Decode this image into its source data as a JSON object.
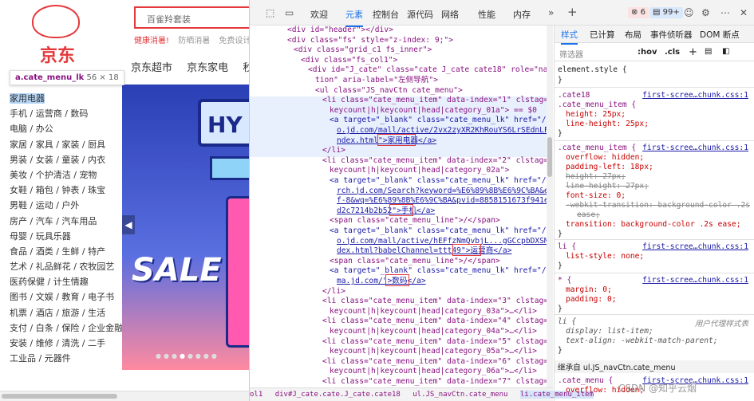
{
  "site": {
    "logo_text": "京东",
    "search_placeholder": "百雀羚套装",
    "hotwords": [
      "健康消暑!",
      "防晒消暑",
      "免费设计"
    ],
    "nav": [
      "京东超市",
      "京东家电",
      "秒杀"
    ],
    "tooltip_selector": "a.cate_menu_lk",
    "tooltip_size": "56 × 18",
    "categories": [
      "家用电器",
      "手机 / 运营商 / 数码",
      "电脑 / 办公",
      "家居 / 家具 / 家装 / 厨具",
      "男装 / 女装 / 童装 / 内衣",
      "美妆 / 个护清洁 / 宠物",
      "女鞋 / 箱包 / 钟表 / 珠宝",
      "男鞋 / 运动 / 户外",
      "房产 / 汽车 / 汽车用品",
      "母婴 / 玩具乐器",
      "食品 / 酒类 / 生鲜 / 特产",
      "艺术 / 礼品鲜花 / 农牧园艺",
      "医药保健 / 计生情趣",
      "图书 / 文娱 / 教育 / 电子书",
      "机票 / 酒店 / 旅游 / 生活",
      "支付 / 白条 / 保险 / 企业金融",
      "安装 / 维修 / 清洗 / 二手",
      "工业品 / 元器件"
    ],
    "banner_hy": "HY",
    "banner_sale": "SALE",
    "banner_arrow": "◀"
  },
  "devtools": {
    "tabs": [
      "欢迎",
      "元素",
      "控制台",
      "源代码",
      "网络",
      "性能",
      "内存"
    ],
    "active_tab": "元素",
    "errors": "6",
    "messages": "99+",
    "dom_lines": [
      "<div id=\"header\"></div>",
      "<div class=\"fs\" style=\"z-index: 9;\">",
      "<div class=\"grid_c1 fs_inner\">",
      "<div class=\"fs_col1\">",
      "<div id=\"J_cate\" class=\"cate J_cate cate18\" role=\"naviga",
      "tion\" aria-label=\"左侧导航\">",
      "<ul class=\"JS_navCtn cate_menu\">",
      "<li class=\"cate_menu_item\" data-index=\"1\" clstag=\"h|",
      "keycount|h|keycount|head|category_01a\"> == $0",
      "<a target=\"_blank\" class=\"cate_menu_lk\" href=\"//pr",
      "o.jd.com/mall/active/2vx2zyXR2KhRouYS6LrSEdnLF1P5/i",
      "ndex.html\">家用电器</a>",
      "</li>",
      "<li class=\"cate_menu_item\" data-index=\"2\" clstag=\"h|",
      "keycount|h|keycount|head|category_02a\">",
      "<a target=\"_blank\" class=\"cate_menu_lk\" href=\"//sea",
      "rch.jd.com/Search?keyword=%E6%89%8B%E6%9C%BA&enc=ut",
      "f-8&wq=%E6%89%8B%E6%9C%BA&pvid=8858151673f941e9b1a4",
      "d2c7214b2b52\">手机</a>",
      "<span class=\"cate_menu_line\">/</span>",
      "<a target=\"_blank\" class=\"cate_menu_lk\" href=\"//pr",
      "o.jd.com/mall/active/hEFfzNmQvbjL...gGCcpbDXSMYkP/in",
      "dex.html?babelChannel=ttt49\">运营商</a>",
      "<span class=\"cate_menu_line\">/</span>",
      "<a target=\"_blank\" class=\"cate_menu_lk\" href=\"//shu",
      "ma.jd.com/\">数码</a>",
      "</li>",
      "<li class=\"cate_menu_item\" data-index=\"3\" clstag=\"h|",
      "keycount|h|keycount|head|category_03a\">…</li>",
      "<li class=\"cate_menu_item\" data-index=\"4\" clstag=\"h|",
      "keycount|h|keycount|head|category_04a\">…</li>",
      "<li class=\"cate_menu_item\" data-index=\"5\" clstag=\"h|",
      "keycount|h|keycount|head|category_05a\">…</li>",
      "<li class=\"cate_menu_item\" data-index=\"6\" clstag=\"h|",
      "keycount|h|keycount|head|category_06a\">…</li>",
      "<li class=\"cate_menu_item\" data-index=\"7\" clstag=\"h|"
    ],
    "breadcrumbs": [
      "ol1",
      "div#J_cate.cate.J_cate.cate18",
      "ul.JS_navCtn.cate_menu",
      "li.cate_menu_item"
    ],
    "styles_tabs": [
      "样式",
      "已计算",
      "布局",
      "事件侦听器",
      "DOM 断点"
    ],
    "filter_placeholder": "筛选器",
    "filter_hov": ":hov",
    "filter_cls": ".cls",
    "style_lines": [
      "element.style {",
      "}",
      ".cate18",
      ".cate_menu_item {",
      "height: 25px;",
      "line-height: 25px;",
      "}",
      ".cate_menu_item {",
      "overflow: hidden;",
      "padding-left: 18px;",
      "height: 27px;",
      "line-height: 27px;",
      "font-size: 0;",
      "-webkit-transition: background-color .2s",
      "ease;",
      "transition: background-color .2s ease;",
      "}",
      "li {",
      "list-style: none;",
      "}",
      "* {",
      "margin: 0;",
      "padding: 0;",
      "}",
      "li {",
      "display: list-item;",
      "text-align: -webkit-match-parent;",
      "}",
      "继承自 ul.JS_navCtn.cate_menu",
      ".cate_menu {",
      "overflow: hidden;"
    ],
    "style_sources": [
      "first-scree…chunk.css:1",
      "first-scree…chunk.css:1",
      "first-scree…chunk.css:1",
      "first-scree…chunk.css:1",
      "first-scree…chunk.css:1"
    ],
    "ua_label": "用户代理样式表"
  },
  "watermark": "CSDN @知乎云烟"
}
